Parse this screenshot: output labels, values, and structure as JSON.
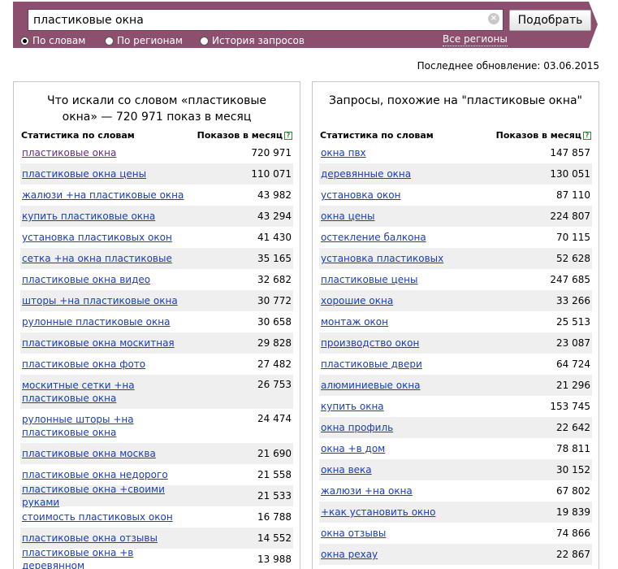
{
  "search": {
    "query": "пластиковые окна",
    "submit_label": "Подобрать",
    "clear_icon": "close-circle-icon",
    "modes": [
      {
        "label": "По словам",
        "selected": true
      },
      {
        "label": "По регионам",
        "selected": false
      },
      {
        "label": "История запросов",
        "selected": false
      }
    ],
    "regions_link": "Все регионы"
  },
  "last_update": "Последнее обновление: 03.06.2015",
  "left_panel": {
    "title_line1": "Что искали со словом «пластиковые",
    "title_line2": "окна» — 720 971 показ в месяц",
    "col_words": "Статистика по словам",
    "col_shows": "Показов в месяц",
    "rows": [
      {
        "phrase": "пластиковые окна",
        "count": "720 971",
        "visited": true
      },
      {
        "phrase": "пластиковые окна цены",
        "count": "110 071"
      },
      {
        "phrase": "жалюзи +на пластиковые окна",
        "count": "43 982"
      },
      {
        "phrase": "купить пластиковые окна",
        "count": "43 294"
      },
      {
        "phrase": "установка пластиковых окон",
        "count": "41 430"
      },
      {
        "phrase": "сетка +на окна пластиковые",
        "count": "35 165"
      },
      {
        "phrase": "пластиковые окна видео",
        "count": "32 682"
      },
      {
        "phrase": "шторы +на пластиковые окна",
        "count": "30 772"
      },
      {
        "phrase": "рулонные пластиковые окна",
        "count": "30 658"
      },
      {
        "phrase": "пластиковые окна москитная",
        "count": "29 828"
      },
      {
        "phrase": "пластиковые окна фото",
        "count": "27 482"
      },
      {
        "phrase": "москитные сетки +на пластиковые окна",
        "count": "26 753",
        "tall": true
      },
      {
        "phrase": "рулонные шторы +на пластиковые окна",
        "count": "24 474",
        "tall": true
      },
      {
        "phrase": "пластиковые окна москва",
        "count": "21 690"
      },
      {
        "phrase": "пластиковые окна недорого",
        "count": "21 558"
      },
      {
        "phrase": "пластиковые окна +своими руками",
        "count": "21 533"
      },
      {
        "phrase": "стоимость пластиковых окон",
        "count": "16 788"
      },
      {
        "phrase": "пластиковые окна отзывы",
        "count": "14 552"
      },
      {
        "phrase": "пластиковые окна +в деревянном",
        "count": "13 988"
      }
    ]
  },
  "right_panel": {
    "title": "Запросы, похожие на \"пластиковые окна\"",
    "col_words": "Статистика по словам",
    "col_shows": "Показов в месяц",
    "rows": [
      {
        "phrase": "окна пвх",
        "count": "147 857"
      },
      {
        "phrase": "деревянные окна",
        "count": "130 051"
      },
      {
        "phrase": "установка окон",
        "count": "87 110"
      },
      {
        "phrase": "окна цены",
        "count": "224 807"
      },
      {
        "phrase": "остекление балкона",
        "count": "70 115"
      },
      {
        "phrase": "установка пластиковых",
        "count": "52 628"
      },
      {
        "phrase": "пластиковые цены",
        "count": "247 685"
      },
      {
        "phrase": "хорошие окна",
        "count": "33 266"
      },
      {
        "phrase": "монтаж окон",
        "count": "25 513"
      },
      {
        "phrase": "производство окон",
        "count": "23 087"
      },
      {
        "phrase": "пластиковые двери",
        "count": "64 724"
      },
      {
        "phrase": "алюминиевые окна",
        "count": "21 296"
      },
      {
        "phrase": "купить окна",
        "count": "153 745"
      },
      {
        "phrase": "окна профиль",
        "count": "22 642"
      },
      {
        "phrase": "окна +в дом",
        "count": "78 811"
      },
      {
        "phrase": "окна века",
        "count": "30 152"
      },
      {
        "phrase": "жалюзи +на окна",
        "count": "67 802"
      },
      {
        "phrase": "+как установить окно",
        "count": "19 839"
      },
      {
        "phrase": "окна отзывы",
        "count": "74 866"
      },
      {
        "phrase": "окна рехау",
        "count": "22 867"
      }
    ]
  }
}
